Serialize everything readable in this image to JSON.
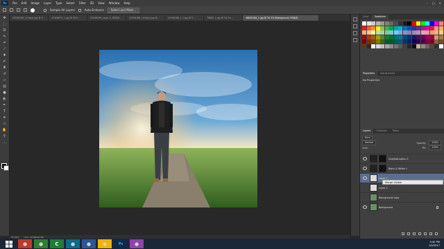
{
  "menubar": {
    "logo": "Ps",
    "items": [
      "File",
      "Edit",
      "Image",
      "Layer",
      "Type",
      "Select",
      "Filter",
      "3D",
      "View",
      "Window",
      "Help"
    ]
  },
  "options": {
    "sample_all_layers": "Sample All Layers",
    "auto_enhance": "Auto-Enhance",
    "refine_edge": "Select and Mask..."
  },
  "tabs": [
    {
      "label": "22558168_1(Copy).jpg @ 5..."
    },
    {
      "label": "47426672_1.jpg @ 50% ..."
    },
    {
      "label": "52598099_Layer 0, RGB/8..."
    },
    {
      "label": "22558168_1(Copy).jpg @..."
    },
    {
      "label": "22558168_1 1.jpg @ 5..."
    },
    {
      "label": "76883_1.jpg @ 33.3% ..."
    },
    {
      "label": "48659186_1.jpg @ 33.3% (Background, RGB/8)",
      "active": true
    }
  ],
  "status": {
    "zoom": "33.33%",
    "doc": "Doc: 22.8M/46.9M"
  },
  "swatches": {
    "tabs": [
      "Color",
      "Swatches"
    ],
    "colors": [
      "#ffffff",
      "#e6e6e6",
      "#cccccc",
      "#b3b3b3",
      "#999999",
      "#808080",
      "#666666",
      "#4d4d4d",
      "#333333",
      "#1a1a1a",
      "#000000",
      "#ff0000",
      "#ffff00",
      "#00ff00",
      "#00ffff",
      "#0000ff",
      "#ff00ff",
      "#ff8080",
      "#ed1c24",
      "#f26522",
      "#f7941d",
      "#fff200",
      "#8dc63f",
      "#39b54a",
      "#00a651",
      "#00a99d",
      "#00aeef",
      "#0072bc",
      "#0054a6",
      "#2e3192",
      "#662d91",
      "#92278f",
      "#ec008c",
      "#ed145b",
      "#f69679",
      "#fbaf5d",
      "#f9ad81",
      "#fdc689",
      "#fff799",
      "#c4df9b",
      "#a3d39c",
      "#82ca9c",
      "#7accc8",
      "#6dcff6",
      "#7da7d9",
      "#8393ca",
      "#8781bd",
      "#a186be",
      "#bd8cbf",
      "#f49ac1",
      "#f5989d",
      "#f7977a",
      "#fbad7a",
      "#fdd07a",
      "#9e0b0f",
      "#a0410d",
      "#a3620a",
      "#aba000",
      "#598527",
      "#1a7b30",
      "#007236",
      "#00746b",
      "#0076a3",
      "#004a80",
      "#003471",
      "#1b1464",
      "#440e62",
      "#630460",
      "#9e005d",
      "#9e0039",
      "#c69c6d",
      "#a67c52",
      "#790000",
      "#7b2e00",
      "#7d4900",
      "#827b00",
      "#406618",
      "#005e20",
      "#005826",
      "#005952",
      "#005b7f",
      "#003663",
      "#002157",
      "#0d004c",
      "#32004b",
      "#4b0049",
      "#7b0046",
      "#7a0026",
      "#8c6239",
      "#754c24",
      "#603913",
      "#3c2415",
      "#f2f2f2",
      "#d9d9d9",
      "#bfbfbf",
      "#a6a6a6",
      "#8c8c8c",
      "#737373",
      "#595959",
      "#404040",
      "#262626",
      "#0d0d0d",
      "#c7b299",
      "#998675",
      "#736357",
      "#534741",
      "#362f2d",
      "#ffffff"
    ]
  },
  "properties": {
    "tabs": [
      "Properties",
      "Adjustments"
    ],
    "empty": "No Properties"
  },
  "layers": {
    "tabs": [
      "Layers",
      "Channels",
      "Paths"
    ],
    "kind": "Kind",
    "blend": "Normal",
    "opacity_label": "Opacity:",
    "opacity": "100%",
    "lock_label": "Lock:",
    "fill_label": "Fill:",
    "fill": "100%",
    "items": [
      {
        "name": "Hue/Saturation 1",
        "thumb": "#ffffff"
      },
      {
        "name": "Black & White 1",
        "thumb": "#ffffff"
      },
      {
        "name": "Layer 1",
        "thumb": "#dcdcdc"
      },
      {
        "name": "Layer 2",
        "thumb": "#dcdcdc"
      },
      {
        "name": "Background copy",
        "thumb": "#6b8e6a"
      },
      {
        "name": "Background",
        "thumb": "#6b8e6a"
      }
    ]
  },
  "context_menu": {
    "item": "Merge Visible"
  },
  "taskbar": {
    "apps": [
      "Ps"
    ],
    "time": "5:40 PM",
    "date": "1/4/2017"
  }
}
